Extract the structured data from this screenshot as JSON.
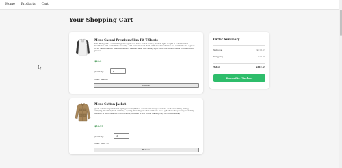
{
  "nav": {
    "links": [
      "Home",
      "Products",
      "Cart"
    ]
  },
  "page": {
    "title": "Your Shopping Cart"
  },
  "cart": {
    "items": [
      {
        "title": "Mens Casual Premium Slim Fit T-Shirts",
        "description": "Slim-fitting style, contrast raglan long sleeve, three-button henley placket, light weight & soft fabric for breathable and comfortable wearing. And Solid stitched shirts with round neck made for durability and a great fit for casual fashion wear and diehard baseball fans. The Henley style round neckline includes a three-button placket.",
        "price": "$22.3",
        "quantity_label": "Quantity:",
        "quantity": "2",
        "total": "Total: $44.60",
        "remove_label": "Remove",
        "image": "tshirt-image"
      },
      {
        "title": "Mens Cotton Jacket",
        "description": "great outerwear jackets for Spring/Autumn/Winter, suitable for many occasions, such as working, hiking, camping, mountain/rock climbing, cycling, traveling or other outdoors. Good gift choice for you or your family member. A warm hearted love to Father, husband or son in this thanksgiving or Christmas Day.",
        "price": "$55.99",
        "quantity_label": "Quantity:",
        "quantity": "3",
        "total": "Total: $167.97",
        "remove_label": "Remove",
        "image": "jacket-image"
      }
    ]
  },
  "summary": {
    "title": "Order Summary",
    "subtotal_label": "Subtotal",
    "subtotal_value": "$212.57",
    "shipping_label": "Shipping",
    "shipping_value": "$10.00",
    "total_label": "Total",
    "total_value": "$222.57",
    "checkout_label": "Proceed to Checkout"
  },
  "colors": {
    "accent": "#2ebd6b",
    "price": "#2e8b40"
  }
}
